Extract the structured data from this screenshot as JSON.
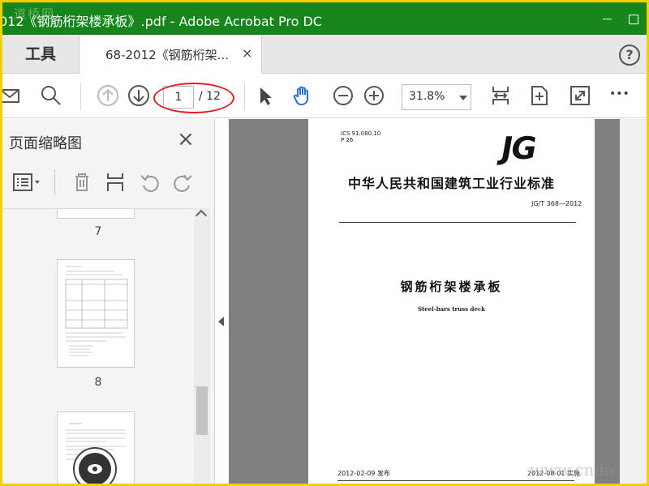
{
  "window": {
    "title": "012《钢筋桁架楼承板》.pdf - Adobe Acrobat Pro DC",
    "watermark_top": "道桥网",
    "watermark_bottom": "www.cnda"
  },
  "tabs": {
    "tools_label": "工具",
    "doc_tab_label": "68-2012《钢筋桁架...",
    "close_glyph": "×",
    "help_glyph": "?"
  },
  "toolbar": {
    "page_current": "1",
    "page_total": "/ 12",
    "zoom": "31.8%",
    "more_glyph": "•••"
  },
  "thumbnail_panel": {
    "title": "页面缩略图",
    "close_glyph": "×",
    "pages": [
      {
        "number": "7"
      },
      {
        "number": "8"
      }
    ]
  },
  "document": {
    "ics": "ICS 91.080.10",
    "category": "P 26",
    "logo": "JG",
    "org": "中华人民共和国建筑工业行业标准",
    "code": "JG/T 368—2012",
    "title": "钢筋桁架楼承板",
    "subtitle": "Steel-bars truss deck",
    "published": "2012-02-09 发布",
    "implemented": "2012-08-01 实施"
  },
  "colors": {
    "title_bar": "#16851b",
    "annotation": "#e02020",
    "hand_tool": "#2a6fdb"
  }
}
